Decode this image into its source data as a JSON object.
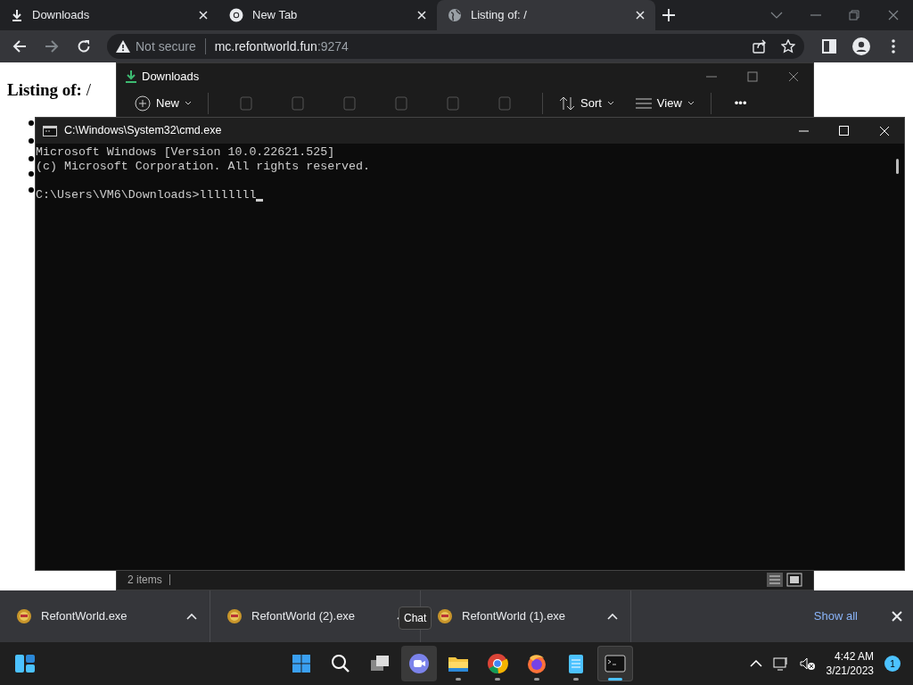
{
  "browser": {
    "tabs": [
      {
        "title": "Downloads",
        "selected": false
      },
      {
        "title": "New Tab",
        "selected": false
      },
      {
        "title": "Listing of: /",
        "selected": true
      }
    ],
    "address": {
      "security": "Not secure",
      "host": "mc.refontworld.fun",
      "port": ":9274"
    }
  },
  "page": {
    "heading": "**Listing of:** /"
  },
  "explorer": {
    "title": "Downloads",
    "toolbar": [
      {
        "label": "New"
      },
      {
        "label": "Sort"
      },
      {
        "label": "View"
      }
    ],
    "more": "•••",
    "status": "2 items"
  },
  "cmd": {
    "title": "C:\\Windows\\System32\\cmd.exe",
    "lines": [
      "Microsoft Windows [Version 10.0.22621.525]",
      "(c) Microsoft Corporation. All rights reserved."
    ],
    "prompt": "C:\\Users\\VM6\\Downloads>llllllll"
  },
  "downloads": {
    "items": [
      {
        "name": "RefontWorld.exe"
      },
      {
        "name": "RefontWorld (2).exe"
      },
      {
        "name": "RefontWorld (1).exe"
      }
    ],
    "show_all": "Show all"
  },
  "tooltip": "Chat",
  "taskbar": {
    "apps": [
      {
        "running": false,
        "selected": false,
        "hovered": false
      },
      {
        "running": false,
        "selected": false,
        "hovered": false
      },
      {
        "running": false,
        "selected": false,
        "hovered": false
      },
      {
        "running": false,
        "selected": false,
        "hovered": true
      },
      {
        "running": true,
        "selected": false,
        "hovered": false
      },
      {
        "running": true,
        "selected": false,
        "hovered": false
      },
      {
        "running": true,
        "selected": false,
        "hovered": false
      },
      {
        "running": true,
        "selected": false,
        "hovered": false
      },
      {
        "running": true,
        "selected": true,
        "hovered": false
      }
    ],
    "time": "4:42 AM",
    "date": "3/21/2023",
    "notifications": "1"
  }
}
